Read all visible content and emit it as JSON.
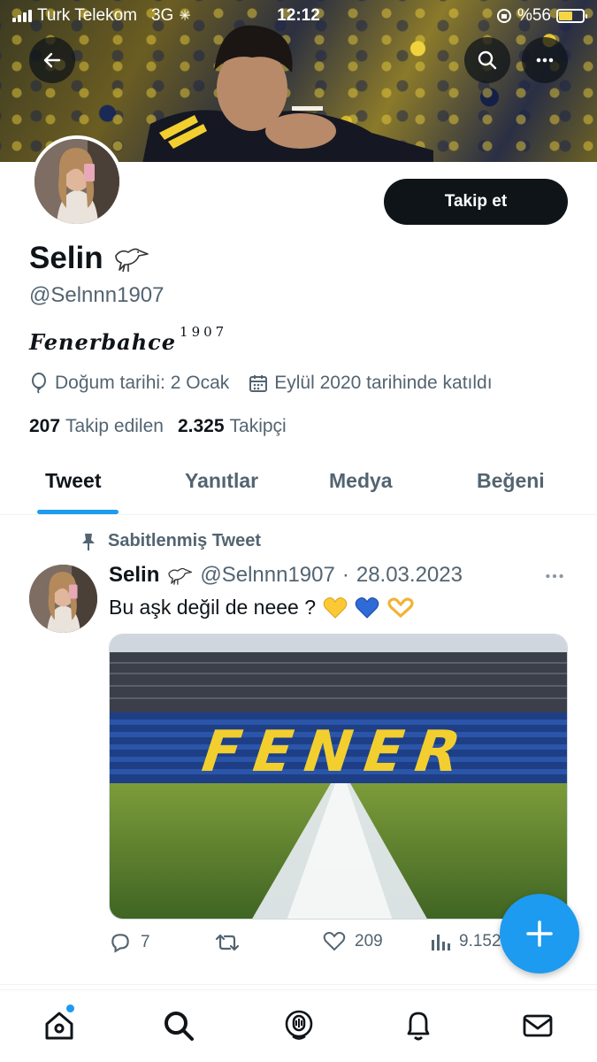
{
  "status_bar": {
    "carrier": "Turk Telekom",
    "network": "3G",
    "time": "12:12",
    "battery": "%56",
    "battery_level": 0.56
  },
  "profile": {
    "name": "Selin",
    "handle": "@Selnnn1907",
    "bio_main": "Fenerbahce",
    "bio_sup": "1907",
    "birthday": "Doğum tarihi: 2 Ocak",
    "joined": "Eylül 2020 tarihinde katıldı",
    "following_count": "207",
    "following_label": "Takip edilen",
    "followers_count": "2.325",
    "followers_label": "Takipçi",
    "follow_button": "Takip et"
  },
  "tabs": [
    "Tweet",
    "Yanıtlar",
    "Medya",
    "Beğeni"
  ],
  "pinned_tweet": {
    "pinned_label": "Sabitlenmiş Tweet",
    "author_name": "Selin",
    "author_handle": "@Selnnn1907",
    "separator": "·",
    "date": "28.03.2023",
    "text": "Bu aşk değil de neee ?",
    "emojis": [
      "yellow-heart",
      "blue-heart",
      "heart-hands"
    ],
    "media_text": "FENER",
    "replies": "7",
    "retweets": "",
    "likes": "209",
    "views": "9.152"
  },
  "colors": {
    "accent": "#1d9bf0",
    "text": "#0f1419",
    "muted": "#536471",
    "fener_yellow": "#f2cf2f",
    "fener_navy": "#1c2f5e"
  },
  "icons": {
    "back": "arrow-left-icon",
    "search": "search-icon",
    "more": "more-horizontal-icon",
    "bird": "bird-icon",
    "birthday": "balloon-icon",
    "calendar": "calendar-icon",
    "pin": "pin-icon",
    "reply": "reply-icon",
    "retweet": "retweet-icon",
    "like": "heart-icon",
    "views": "views-icon",
    "compose": "plus-icon",
    "home": "home-icon",
    "explore": "search-icon",
    "spaces": "spaces-icon",
    "notifications": "bell-icon",
    "messages": "mail-icon"
  }
}
